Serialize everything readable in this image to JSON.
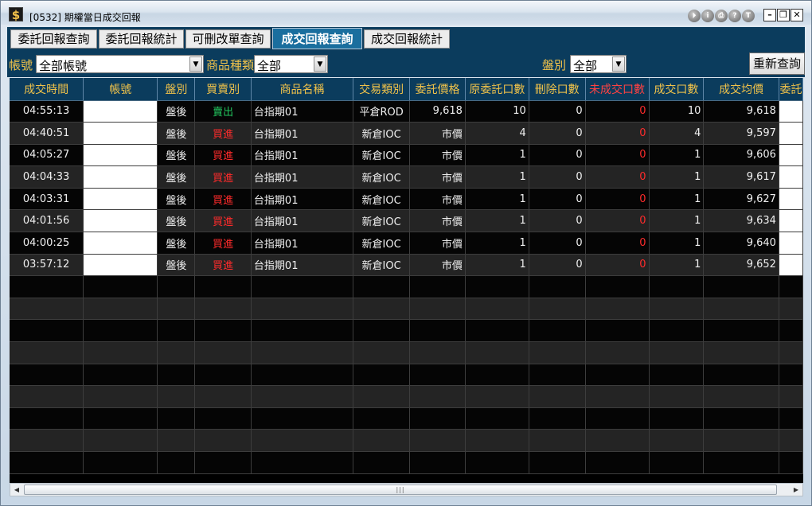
{
  "window": {
    "app_icon": "$",
    "title": "[0532] 期權當日成交回報",
    "toolbar_icons": [
      "exit-icon",
      "info-icon",
      "print-icon",
      "help-icon",
      "t-icon"
    ],
    "toolbar_glyphs": [
      "⏵",
      "i",
      "⎙",
      "?",
      "T"
    ],
    "minimize": "–",
    "maximize": "❐",
    "close": "✕"
  },
  "tabs": [
    {
      "label": "委託回報查詢",
      "active": false
    },
    {
      "label": "委託回報統計",
      "active": false
    },
    {
      "label": "可刪改單查詢",
      "active": false
    },
    {
      "label": "成交回報查詢",
      "active": true
    },
    {
      "label": "成交回報統計",
      "active": false
    }
  ],
  "filters": {
    "account_label": "帳號",
    "account_value": "全部帳號",
    "product_label": "商品種類",
    "product_value": "全部",
    "session_label": "盤別",
    "session_value": "全部",
    "requery_label": "重新查詢",
    "dropdown_arrow": "▼"
  },
  "table": {
    "columns": [
      "成交時間",
      "帳號",
      "盤別",
      "買賣別",
      "商品名稱",
      "交易類別",
      "委託價格",
      "原委託口數",
      "刪除口數",
      "未成交口數",
      "成交口數",
      "成交均價",
      "委託"
    ],
    "rows": [
      {
        "time": "04:55:13",
        "account": "",
        "session": "盤後",
        "side": "賣出",
        "product": "台指期01",
        "trade_type": "平倉ROD",
        "price": "9,618",
        "orig_qty": "10",
        "del_qty": "0",
        "unfilled": "0",
        "filled": "10",
        "avg_price": "9,618"
      },
      {
        "time": "04:40:51",
        "account": "",
        "session": "盤後",
        "side": "買進",
        "product": "台指期01",
        "trade_type": "新倉IOC",
        "price": "市價",
        "orig_qty": "4",
        "del_qty": "0",
        "unfilled": "0",
        "filled": "4",
        "avg_price": "9,597"
      },
      {
        "time": "04:05:27",
        "account": "",
        "session": "盤後",
        "side": "買進",
        "product": "台指期01",
        "trade_type": "新倉IOC",
        "price": "市價",
        "orig_qty": "1",
        "del_qty": "0",
        "unfilled": "0",
        "filled": "1",
        "avg_price": "9,606"
      },
      {
        "time": "04:04:33",
        "account": "",
        "session": "盤後",
        "side": "買進",
        "product": "台指期01",
        "trade_type": "新倉IOC",
        "price": "市價",
        "orig_qty": "1",
        "del_qty": "0",
        "unfilled": "0",
        "filled": "1",
        "avg_price": "9,617"
      },
      {
        "time": "04:03:31",
        "account": "",
        "session": "盤後",
        "side": "買進",
        "product": "台指期01",
        "trade_type": "新倉IOC",
        "price": "市價",
        "orig_qty": "1",
        "del_qty": "0",
        "unfilled": "0",
        "filled": "1",
        "avg_price": "9,627"
      },
      {
        "time": "04:01:56",
        "account": "",
        "session": "盤後",
        "side": "買進",
        "product": "台指期01",
        "trade_type": "新倉IOC",
        "price": "市價",
        "orig_qty": "1",
        "del_qty": "0",
        "unfilled": "0",
        "filled": "1",
        "avg_price": "9,634"
      },
      {
        "time": "04:00:25",
        "account": "",
        "session": "盤後",
        "side": "買進",
        "product": "台指期01",
        "trade_type": "新倉IOC",
        "price": "市價",
        "orig_qty": "1",
        "del_qty": "0",
        "unfilled": "0",
        "filled": "1",
        "avg_price": "9,640"
      },
      {
        "time": "03:57:12",
        "account": "",
        "session": "盤後",
        "side": "買進",
        "product": "台指期01",
        "trade_type": "新倉IOC",
        "price": "市價",
        "orig_qty": "1",
        "del_qty": "0",
        "unfilled": "0",
        "filled": "1",
        "avg_price": "9,652"
      }
    ]
  },
  "scrollbar": {
    "left_arrow": "◀",
    "right_arrow": "▶",
    "grip": "|||"
  },
  "colors": {
    "header_bg": "#0b3c5d",
    "header_text": "#f0c24a",
    "sell": "#22c55e",
    "buy": "#ff2b2b"
  }
}
